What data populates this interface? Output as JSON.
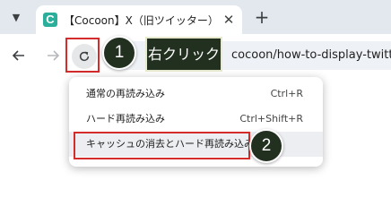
{
  "browser": {
    "tab": {
      "favicon_letter": "C",
      "title": "【Cocoon】X（旧ツイッター）のSNS"
    },
    "url_visible": "cocoon/how-to-display-twitte"
  },
  "annotations": {
    "step1": "1",
    "step1_label": "右クリック",
    "step2": "2",
    "highlight_color": "#d42b2b",
    "badge_color": "#223020"
  },
  "context_menu": {
    "items": [
      {
        "label": "通常の再読み込み",
        "shortcut": "Ctrl+R"
      },
      {
        "label": "ハード再読み込み",
        "shortcut": "Ctrl+Shift+R"
      },
      {
        "label": "キャッシュの消去とハード再読み込み",
        "shortcut": ""
      }
    ]
  },
  "icons": [
    "chevron-down-icon",
    "close-icon",
    "plus-icon",
    "back-arrow-icon",
    "forward-arrow-icon",
    "reload-icon"
  ]
}
